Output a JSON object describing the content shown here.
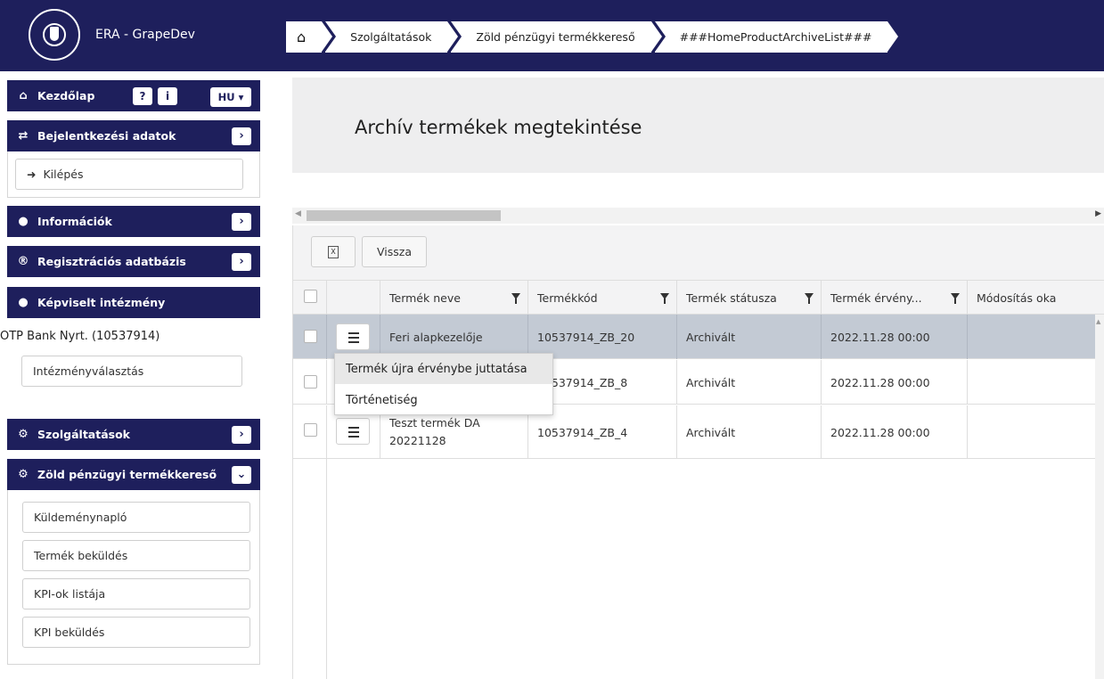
{
  "app": {
    "title": "ERA - GrapeDev"
  },
  "breadcrumb": {
    "items": [
      "Szolgáltatások",
      "Zöld pénzügyi termékkereső",
      "###HomeProductArchiveList###"
    ]
  },
  "sidebar": {
    "home_label": "Kezdőlap",
    "lang": "HU ▾",
    "login_data_label": "Bejelentkezési adatok",
    "logout_label": "Kilépés",
    "info_label": "Információk",
    "registry_label": "Regisztrációs adatbázis",
    "represented_label": "Képviselt intézmény",
    "institution": "OTP Bank Nyrt. (10537914)",
    "institution_select_label": "Intézményválasztás",
    "services_label": "Szolgáltatások",
    "green_label": "Zöld pénzügyi termékkereső",
    "green_items": [
      "Küldeménynapló",
      "Termék beküldés",
      "KPI-ok listája",
      "KPI beküldés"
    ]
  },
  "main": {
    "page_title": "Archív termékek megtekintése",
    "back_label": "Vissza",
    "excel_glyph": "X",
    "columns": [
      "Termék neve",
      "Termékkód",
      "Termék státusza",
      "Termék érvény...",
      "Módosítás oka"
    ],
    "rows": [
      {
        "name": "Feri alapkezelője",
        "code": "10537914_ZB_20",
        "status": "Archivált",
        "valid": "2022.11.28 00:00",
        "reason": ""
      },
      {
        "name": "",
        "code": "10537914_ZB_8",
        "status": "Archivált",
        "valid": "2022.11.28 00:00",
        "reason": ""
      },
      {
        "name": "Teszt termék DA 20221128",
        "code": "10537914_ZB_4",
        "status": "Archivált",
        "valid": "2022.11.28 00:00",
        "reason": ""
      }
    ],
    "context_menu": [
      "Termék újra érvénybe juttatása",
      "Történetiség"
    ]
  },
  "colors": {
    "navy": "#1e1f5c",
    "selected_row": "#c3cad4"
  }
}
